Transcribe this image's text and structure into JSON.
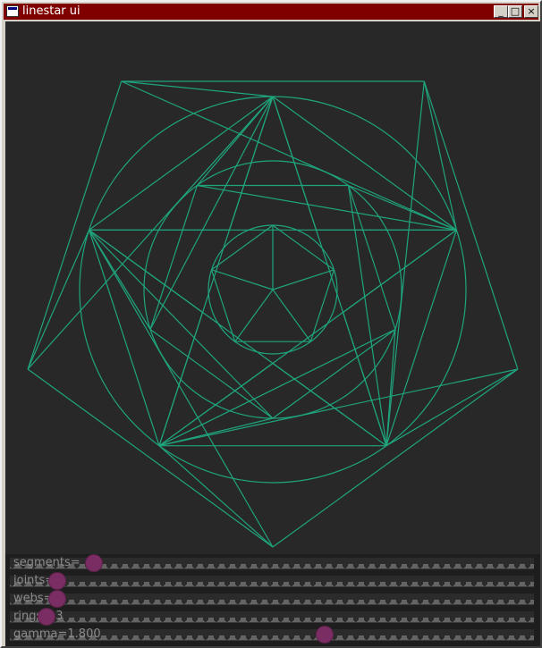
{
  "window": {
    "title": "linestar ui",
    "buttons": {
      "minimize": "_",
      "maximize": "□",
      "close": "×"
    }
  },
  "colors": {
    "titlebar": "#800000",
    "canvas_bg": "#282828",
    "line": "#1fa57d",
    "knob": "#7a2d63"
  },
  "controls": [
    {
      "label": "segments=",
      "value_fraction": 0.16
    },
    {
      "label": "joints=4",
      "value_fraction": 0.09
    },
    {
      "label": "webs=",
      "value_fraction": 0.09
    },
    {
      "label": "rings= 3",
      "value_fraction": 0.07
    },
    {
      "label": "gamma=1.800",
      "value_fraction": 0.6
    }
  ]
}
